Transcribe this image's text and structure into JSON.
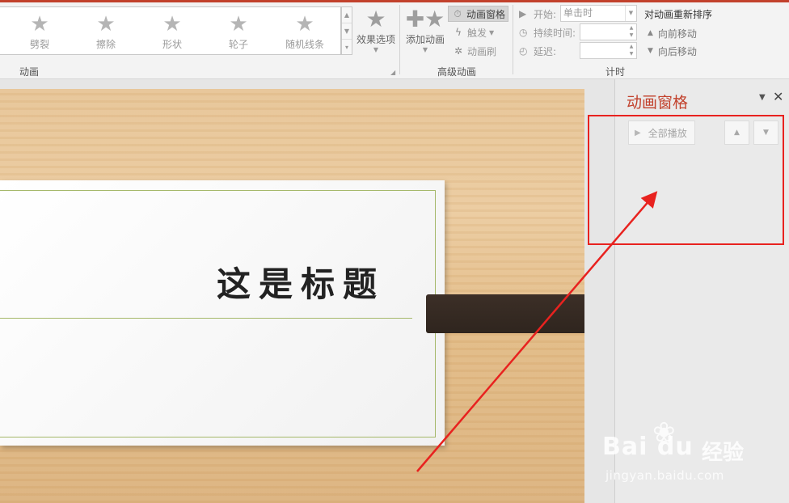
{
  "ribbon": {
    "animation_gallery": [
      {
        "label": "劈裂",
        "icon": "split-star-icon"
      },
      {
        "label": "擦除",
        "icon": "wipe-star-icon"
      },
      {
        "label": "形状",
        "icon": "shape-star-icon"
      },
      {
        "label": "轮子",
        "icon": "wheel-star-icon"
      },
      {
        "label": "随机线条",
        "icon": "random-bars-star-icon"
      }
    ],
    "effect_options_label": "效果选项",
    "animation_group_label": "动画",
    "advanced": {
      "add_animation_label": "添加动画",
      "animation_pane_label": "动画窗格",
      "trigger_label": "触发",
      "painter_label": "动画刷",
      "group_label": "高级动画"
    },
    "timing": {
      "start_label": "开始:",
      "start_value": "单击时",
      "duration_label": "持续时间:",
      "duration_value": "",
      "delay_label": "延迟:",
      "delay_value": "",
      "group_label": "计时"
    },
    "reorder": {
      "title": "对动画重新排序",
      "move_earlier": "向前移动",
      "move_later": "向后移动"
    }
  },
  "slide": {
    "title": "这是标题"
  },
  "animation_pane": {
    "title": "动画窗格",
    "play_all_label": "全部播放"
  },
  "watermark": {
    "logo": "Bai du",
    "cn": "经验",
    "url": "jingyan.baidu.com"
  },
  "colors": {
    "accent": "#c2412c",
    "highlight": "#e8221f"
  }
}
